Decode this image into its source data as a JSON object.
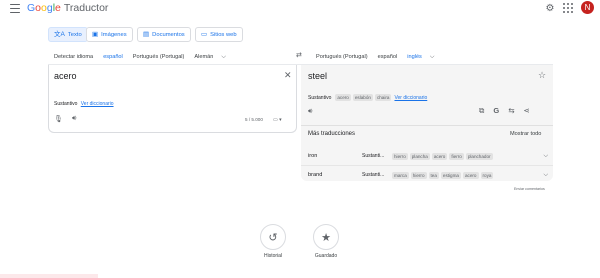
{
  "header": {
    "logo_letters": [
      {
        "ch": "G",
        "color": "#4285f4"
      },
      {
        "ch": "o",
        "color": "#ea4335"
      },
      {
        "ch": "o",
        "color": "#fbbc05"
      },
      {
        "ch": "g",
        "color": "#4285f4"
      },
      {
        "ch": "l",
        "color": "#34a853"
      },
      {
        "ch": "e",
        "color": "#ea4335"
      }
    ],
    "product": "Traductor",
    "avatar_initial": "N",
    "avatar_color": "#c5221f"
  },
  "modes": {
    "text": {
      "icon": "文A",
      "label": "Texto"
    },
    "images": {
      "icon": "▣",
      "label": "Imágenes"
    },
    "documents": {
      "icon": "▤",
      "label": "Documentos"
    },
    "websites": {
      "icon": "▭",
      "label": "Sitios web"
    }
  },
  "source_langs": {
    "detect": "Detectar idioma",
    "l1": "español",
    "l2": "Portugués (Portugal)",
    "l3": "Alemán"
  },
  "target_langs": {
    "l1": "Portugués (Portugal)",
    "l2": "español",
    "l3": "inglés"
  },
  "source": {
    "text": "acero",
    "pos": "Sustantivo",
    "dict_link": "Ver diccionario",
    "char_count": "5 / 5.000"
  },
  "target": {
    "text": "steel",
    "pos": "Sustantivo",
    "synonyms": [
      "acero",
      "eslabón",
      "chaira"
    ],
    "dict_link": "Ver diccionario"
  },
  "more": {
    "title": "Más traducciones",
    "show_all": "Mostrar todo",
    "rows": [
      {
        "word": "iron",
        "pos": "Sustanti...",
        "chips": [
          "hierro",
          "plancha",
          "acero",
          "fierro",
          "planchador"
        ]
      },
      {
        "word": "brand",
        "pos": "Sustanti...",
        "chips": [
          "marca",
          "hierro",
          "tea",
          "estigma",
          "acero",
          "roya"
        ]
      }
    ]
  },
  "feedback": "Enviar comentarios",
  "bottom": {
    "history": "Historial",
    "saved": "Guardado"
  },
  "colors": {
    "accent": "#1a73e8"
  }
}
